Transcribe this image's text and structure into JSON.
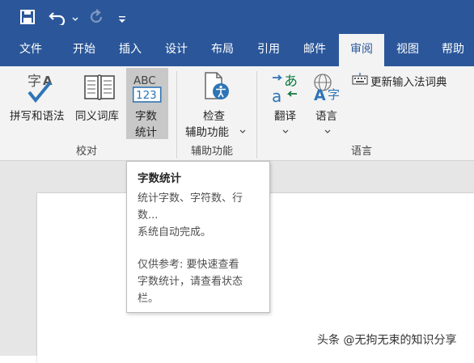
{
  "qat": {
    "icons": [
      "save-icon",
      "undo-icon",
      "undo-dropdown-icon",
      "redo-icon",
      "customize-qat-icon"
    ],
    "color": "#2b579a"
  },
  "tabs": [
    {
      "label": "文件"
    },
    {
      "label": "开始"
    },
    {
      "label": "插入"
    },
    {
      "label": "设计"
    },
    {
      "label": "布局"
    },
    {
      "label": "引用"
    },
    {
      "label": "邮件"
    },
    {
      "label": "审阅",
      "active": true
    },
    {
      "label": "视图"
    },
    {
      "label": "帮助"
    }
  ],
  "ribbon": {
    "spelling_label": "拼写和语法",
    "thesaurus_label": "同义词库",
    "wordcount_line1": "字数",
    "wordcount_line2": "统计",
    "wordcount_icon_text": "ABC",
    "wordcount_icon_num": "123",
    "spelling_icon_char": "字",
    "spelling_icon_letter": "A",
    "check_line1": "检查",
    "check_line2": "辅助功能",
    "translate_label": "翻译",
    "translate_icon_char": "あ",
    "translate_icon_letter": "a",
    "language_label": "语言",
    "language_icon_char": "字",
    "update_ime_label": "更新输入法词典",
    "groups": {
      "proofing": "校对",
      "accessibility": "辅助功能",
      "language": "语言"
    }
  },
  "tooltip": {
    "title": "字数统计",
    "line1": "统计字数、字符数、行",
    "line2": "数...",
    "line3": "系统自动完成。",
    "line4": "仅供参考: 要快速查看",
    "line5": "字数统计，请查看状态",
    "line6": "栏。"
  },
  "watermark": "头条 @无拘无束的知识分享"
}
